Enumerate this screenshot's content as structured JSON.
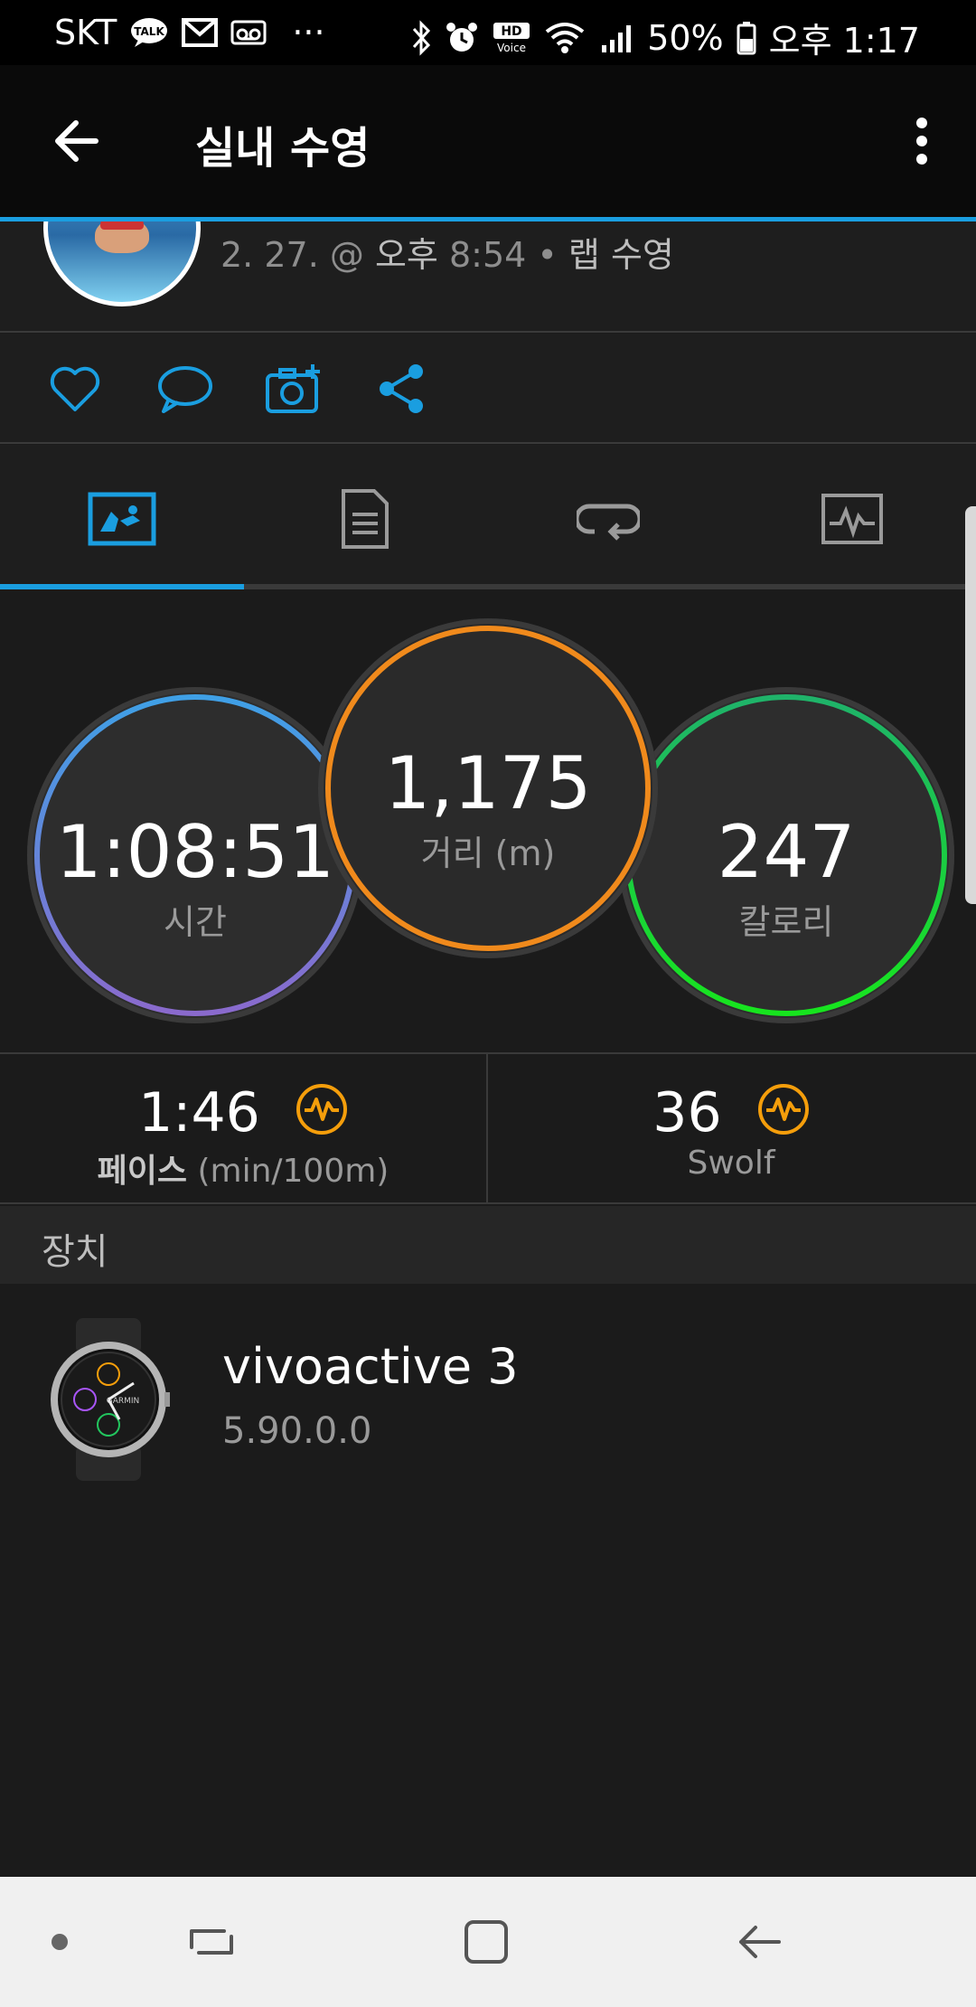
{
  "status_bar": {
    "carrier": "SKT",
    "talk_badge": "TALK",
    "overflow": "···",
    "hd_voice_top": "HD",
    "hd_voice_bottom": "Voice",
    "battery": "50%",
    "time": "오후 1:17"
  },
  "app_bar": {
    "title": "실내 수영"
  },
  "activity": {
    "date_prefix": "2. 27. @",
    "time": "오후",
    "time_value": "8:54",
    "separator": "•",
    "type": "랩 수영"
  },
  "rings": [
    {
      "value": "1:08:51",
      "label": "시간"
    },
    {
      "value": "1,175",
      "label": "거리 (m)"
    },
    {
      "value": "247",
      "label": "칼로리"
    }
  ],
  "metrics": {
    "pace": {
      "value": "1:46",
      "label_bold": "페이스",
      "label_unit": "(min/100m)"
    },
    "swolf": {
      "value": "36",
      "label": "Swolf"
    }
  },
  "section": {
    "device_header": "장치"
  },
  "device": {
    "name": "vivoactive 3",
    "version": "5.90.0.0",
    "watch_brand": "GARMIN"
  },
  "colors": {
    "accent": "#1a9ee0",
    "time_ring": "#4a9fe0",
    "distance_ring": "#f08a1c",
    "calorie_ring": "#22c55e",
    "metric_icon": "#f59e0b"
  }
}
